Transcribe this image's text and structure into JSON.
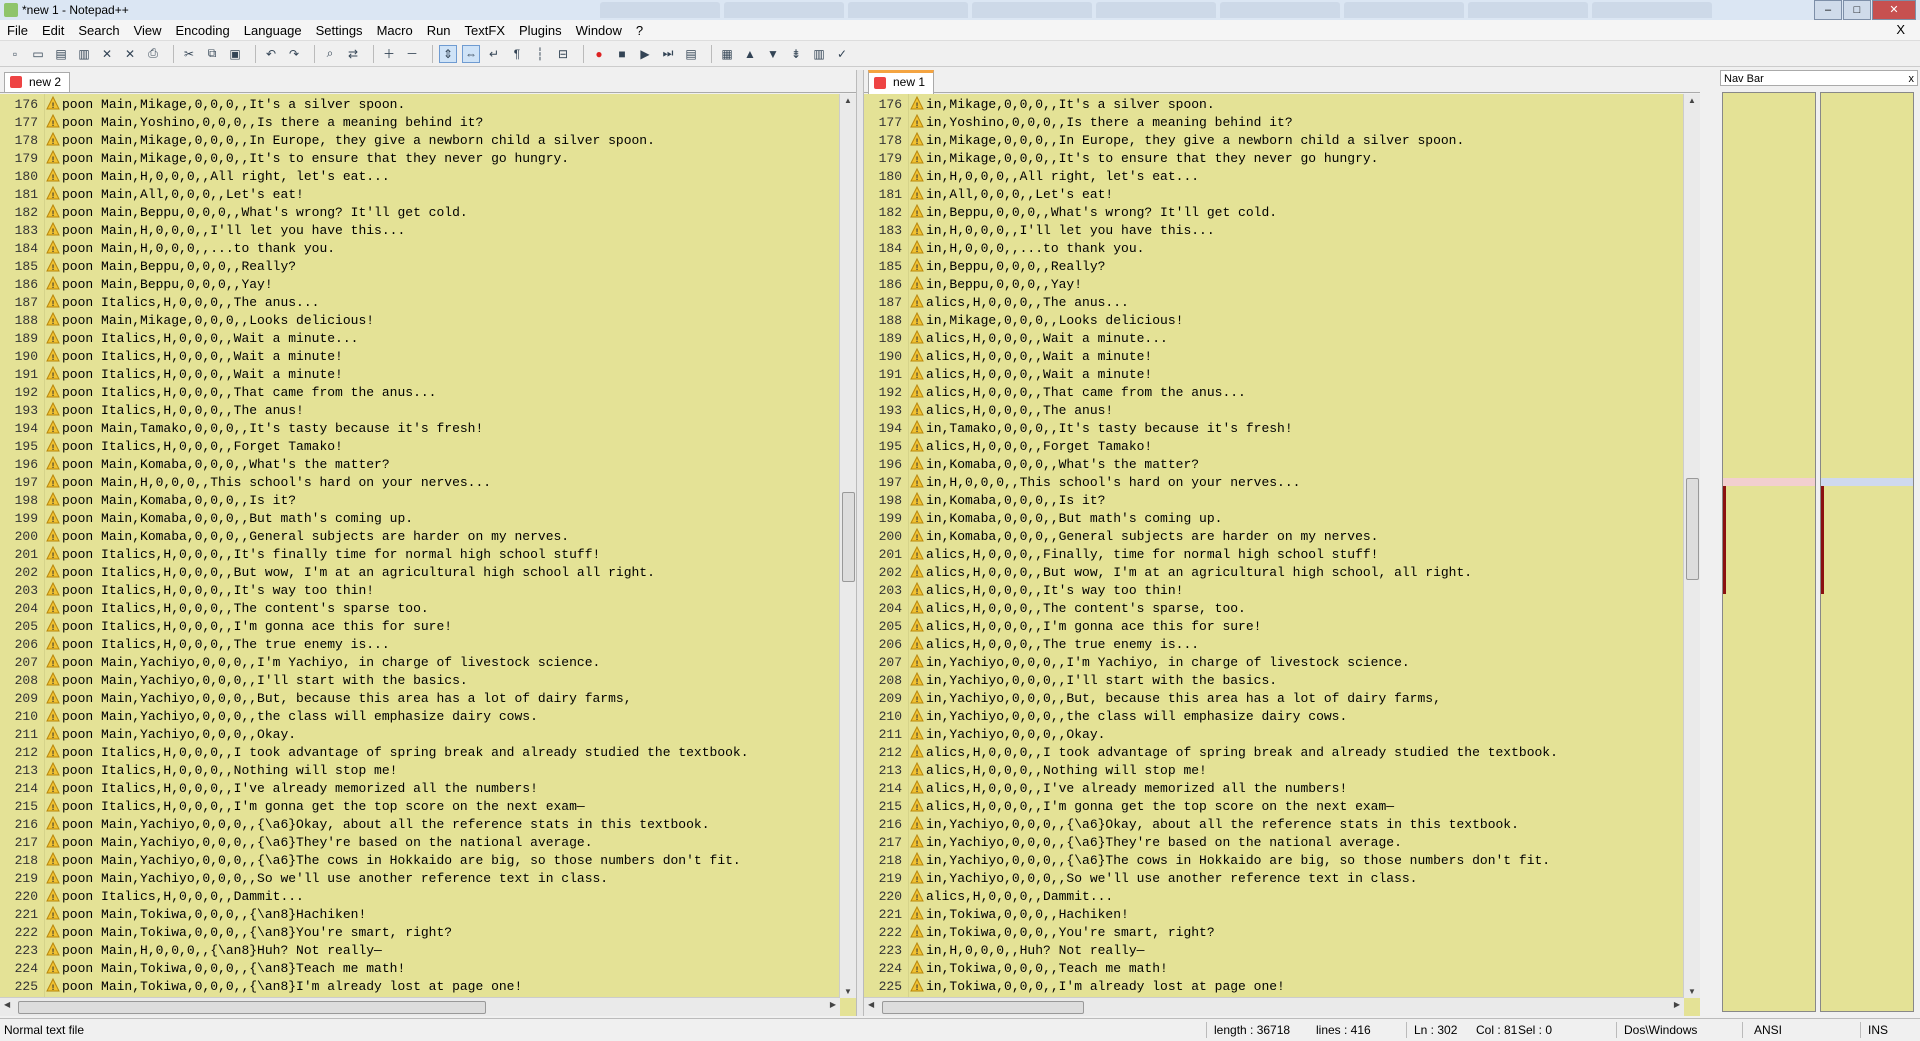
{
  "window": {
    "title": "*new 1 - Notepad++"
  },
  "menu": [
    "File",
    "Edit",
    "Search",
    "View",
    "Encoding",
    "Language",
    "Settings",
    "Macro",
    "Run",
    "TextFX",
    "Plugins",
    "Window",
    "?"
  ],
  "menu_close": "X",
  "toolbar_icons": [
    "new-file-icon",
    "open-file-icon",
    "save-icon",
    "save-all-icon",
    "close-icon",
    "close-all-icon",
    "print-icon",
    "cut-icon",
    "copy-icon",
    "paste-icon",
    "undo-icon",
    "redo-icon",
    "find-icon",
    "replace-icon",
    "zoom-in-icon",
    "zoom-out-icon",
    "sync-vertical-icon",
    "sync-horizontal-icon",
    "word-wrap-icon",
    "show-all-chars-icon",
    "indent-guide-icon",
    "fold-icon",
    "record-macro-icon",
    "stop-macro-icon",
    "play-macro-icon",
    "run-macro-multiple-icon",
    "save-macro-icon",
    "compare-icon",
    "prev-diff-icon",
    "next-diff-icon",
    "last-diff-icon",
    "navbar-icon",
    "spellcheck-icon"
  ],
  "left_pane": {
    "tab_label": "new 2",
    "prefix": "poon ",
    "lines": [
      {
        "n": "176",
        "t": "Main,Mikage,0,0,0,,It's a silver spoon."
      },
      {
        "n": "177",
        "t": "Main,Yoshino,0,0,0,,Is there a meaning behind it?"
      },
      {
        "n": "178",
        "t": "Main,Mikage,0,0,0,,In Europe, they give a newborn child a silver spoon."
      },
      {
        "n": "179",
        "t": "Main,Mikage,0,0,0,,It's to ensure that they never go hungry."
      },
      {
        "n": "180",
        "t": "Main,H,0,0,0,,All right, let's eat..."
      },
      {
        "n": "181",
        "t": "Main,All,0,0,0,,Let's eat!"
      },
      {
        "n": "182",
        "t": "Main,Beppu,0,0,0,,What's wrong? It'll get cold."
      },
      {
        "n": "183",
        "t": "Main,H,0,0,0,,I'll let you have this..."
      },
      {
        "n": "184",
        "t": "Main,H,0,0,0,,...to thank you."
      },
      {
        "n": "185",
        "t": "Main,Beppu,0,0,0,,Really?"
      },
      {
        "n": "186",
        "t": "Main,Beppu,0,0,0,,Yay!"
      },
      {
        "n": "187",
        "t": "Italics,H,0,0,0,,The anus..."
      },
      {
        "n": "188",
        "t": "Main,Mikage,0,0,0,,Looks delicious!"
      },
      {
        "n": "189",
        "t": "Italics,H,0,0,0,,Wait a minute..."
      },
      {
        "n": "190",
        "t": "Italics,H,0,0,0,,Wait a minute!"
      },
      {
        "n": "191",
        "t": "Italics,H,0,0,0,,Wait a minute!"
      },
      {
        "n": "192",
        "t": "Italics,H,0,0,0,,That came from the anus..."
      },
      {
        "n": "193",
        "t": "Italics,H,0,0,0,,The anus!"
      },
      {
        "n": "194",
        "t": "Main,Tamako,0,0,0,,It's tasty because it's fresh!"
      },
      {
        "n": "195",
        "t": "Italics,H,0,0,0,,Forget Tamako!"
      },
      {
        "n": "196",
        "t": "Main,Komaba,0,0,0,,What's the matter?"
      },
      {
        "n": "197",
        "t": "Main,H,0,0,0,,This school's hard on your nerves..."
      },
      {
        "n": "198",
        "t": "Main,Komaba,0,0,0,,Is it?"
      },
      {
        "n": "199",
        "t": "Main,Komaba,0,0,0,,But math's coming up."
      },
      {
        "n": "200",
        "t": "Main,Komaba,0,0,0,,General subjects are harder on my nerves."
      },
      {
        "n": "201",
        "t": "Italics,H,0,0,0,,It's finally time for normal high school stuff!"
      },
      {
        "n": "202",
        "t": "Italics,H,0,0,0,,But wow, I'm at an agricultural high school all right."
      },
      {
        "n": "203",
        "t": "Italics,H,0,0,0,,It's way too thin!"
      },
      {
        "n": "204",
        "t": "Italics,H,0,0,0,,The content's sparse too."
      },
      {
        "n": "205",
        "t": "Italics,H,0,0,0,,I'm gonna ace this for sure!"
      },
      {
        "n": "206",
        "t": "Italics,H,0,0,0,,The true enemy is..."
      },
      {
        "n": "207",
        "t": "Main,Yachiyo,0,0,0,,I'm Yachiyo, in charge of livestock science."
      },
      {
        "n": "208",
        "t": "Main,Yachiyo,0,0,0,,I'll start with the basics."
      },
      {
        "n": "209",
        "t": "Main,Yachiyo,0,0,0,,But, because this area has a lot of dairy farms,"
      },
      {
        "n": "210",
        "t": "Main,Yachiyo,0,0,0,,the class will emphasize dairy cows."
      },
      {
        "n": "211",
        "t": "Main,Yachiyo,0,0,0,,Okay."
      },
      {
        "n": "212",
        "t": "Italics,H,0,0,0,,I took advantage of spring break and already studied the textbook."
      },
      {
        "n": "213",
        "t": "Italics,H,0,0,0,,Nothing will stop me!"
      },
      {
        "n": "214",
        "t": "Italics,H,0,0,0,,I've already memorized all the numbers!"
      },
      {
        "n": "215",
        "t": "Italics,H,0,0,0,,I'm gonna get the top score on the next exam—"
      },
      {
        "n": "216",
        "t": "Main,Yachiyo,0,0,0,,{\\a6}Okay, about all the reference stats in this textbook."
      },
      {
        "n": "217",
        "t": "Main,Yachiyo,0,0,0,,{\\a6}They're based on the national average."
      },
      {
        "n": "218",
        "t": "Main,Yachiyo,0,0,0,,{\\a6}The cows in Hokkaido are big, so those numbers don't fit."
      },
      {
        "n": "219",
        "t": "Main,Yachiyo,0,0,0,,So we'll use another reference text in class."
      },
      {
        "n": "220",
        "t": "Italics,H,0,0,0,,Dammit..."
      },
      {
        "n": "221",
        "t": "Main,Tokiwa,0,0,0,,{\\an8}Hachiken!"
      },
      {
        "n": "222",
        "t": "Main,Tokiwa,0,0,0,,{\\an8}You're smart, right?"
      },
      {
        "n": "223",
        "t": "Main,H,0,0,0,,{\\an8}Huh? Not really—"
      },
      {
        "n": "224",
        "t": "Main,Tokiwa,0,0,0,,{\\an8}Teach me math!"
      },
      {
        "n": "225",
        "t": "Main,Tokiwa,0,0,0,,{\\an8}I'm already lost at page one!"
      }
    ]
  },
  "right_pane": {
    "tab_label": "new 1",
    "lines": [
      {
        "n": "176",
        "t": "in,Mikage,0,0,0,,It's a silver spoon."
      },
      {
        "n": "177",
        "t": "in,Yoshino,0,0,0,,Is there a meaning behind it?"
      },
      {
        "n": "178",
        "t": "in,Mikage,0,0,0,,In Europe, they give a newborn child a silver spoon."
      },
      {
        "n": "179",
        "t": "in,Mikage,0,0,0,,It's to ensure that they never go hungry."
      },
      {
        "n": "180",
        "t": "in,H,0,0,0,,All right, let's eat..."
      },
      {
        "n": "181",
        "t": "in,All,0,0,0,,Let's eat!"
      },
      {
        "n": "182",
        "t": "in,Beppu,0,0,0,,What's wrong? It'll get cold."
      },
      {
        "n": "183",
        "t": "in,H,0,0,0,,I'll let you have this..."
      },
      {
        "n": "184",
        "t": "in,H,0,0,0,,...to thank you."
      },
      {
        "n": "185",
        "t": "in,Beppu,0,0,0,,Really?"
      },
      {
        "n": "186",
        "t": "in,Beppu,0,0,0,,Yay!"
      },
      {
        "n": "187",
        "t": "alics,H,0,0,0,,The anus..."
      },
      {
        "n": "188",
        "t": "in,Mikage,0,0,0,,Looks delicious!"
      },
      {
        "n": "189",
        "t": "alics,H,0,0,0,,Wait a minute..."
      },
      {
        "n": "190",
        "t": "alics,H,0,0,0,,Wait a minute!"
      },
      {
        "n": "191",
        "t": "alics,H,0,0,0,,Wait a minute!"
      },
      {
        "n": "192",
        "t": "alics,H,0,0,0,,That came from the anus..."
      },
      {
        "n": "193",
        "t": "alics,H,0,0,0,,The anus!"
      },
      {
        "n": "194",
        "t": "in,Tamako,0,0,0,,It's tasty because it's fresh!"
      },
      {
        "n": "195",
        "t": "alics,H,0,0,0,,Forget Tamako!"
      },
      {
        "n": "196",
        "t": "in,Komaba,0,0,0,,What's the matter?"
      },
      {
        "n": "197",
        "t": "in,H,0,0,0,,This school's hard on your nerves..."
      },
      {
        "n": "198",
        "t": "in,Komaba,0,0,0,,Is it?"
      },
      {
        "n": "199",
        "t": "in,Komaba,0,0,0,,But math's coming up."
      },
      {
        "n": "200",
        "t": "in,Komaba,0,0,0,,General subjects are harder on my nerves."
      },
      {
        "n": "201",
        "t": "alics,H,0,0,0,,Finally, time for normal high school stuff!"
      },
      {
        "n": "202",
        "t": "alics,H,0,0,0,,But wow, I'm at an agricultural high school, all right."
      },
      {
        "n": "203",
        "t": "alics,H,0,0,0,,It's way too thin!"
      },
      {
        "n": "204",
        "t": "alics,H,0,0,0,,The content's sparse, too."
      },
      {
        "n": "205",
        "t": "alics,H,0,0,0,,I'm gonna ace this for sure!"
      },
      {
        "n": "206",
        "t": "alics,H,0,0,0,,The true enemy is..."
      },
      {
        "n": "207",
        "t": "in,Yachiyo,0,0,0,,I'm Yachiyo, in charge of livestock science."
      },
      {
        "n": "208",
        "t": "in,Yachiyo,0,0,0,,I'll start with the basics."
      },
      {
        "n": "209",
        "t": "in,Yachiyo,0,0,0,,But, because this area has a lot of dairy farms,"
      },
      {
        "n": "210",
        "t": "in,Yachiyo,0,0,0,,the class will emphasize dairy cows."
      },
      {
        "n": "211",
        "t": "in,Yachiyo,0,0,0,,Okay."
      },
      {
        "n": "212",
        "t": "alics,H,0,0,0,,I took advantage of spring break and already studied the textbook."
      },
      {
        "n": "213",
        "t": "alics,H,0,0,0,,Nothing will stop me!"
      },
      {
        "n": "214",
        "t": "alics,H,0,0,0,,I've already memorized all the numbers!"
      },
      {
        "n": "215",
        "t": "alics,H,0,0,0,,I'm gonna get the top score on the next exam—"
      },
      {
        "n": "216",
        "t": "in,Yachiyo,0,0,0,,{\\a6}Okay, about all the reference stats in this textbook."
      },
      {
        "n": "217",
        "t": "in,Yachiyo,0,0,0,,{\\a6}They're based on the national average."
      },
      {
        "n": "218",
        "t": "in,Yachiyo,0,0,0,,{\\a6}The cows in Hokkaido are big, so those numbers don't fit."
      },
      {
        "n": "219",
        "t": "in,Yachiyo,0,0,0,,So we'll use another reference text in class."
      },
      {
        "n": "220",
        "t": "alics,H,0,0,0,,Dammit..."
      },
      {
        "n": "221",
        "t": "in,Tokiwa,0,0,0,,Hachiken!"
      },
      {
        "n": "222",
        "t": "in,Tokiwa,0,0,0,,You're smart, right?"
      },
      {
        "n": "223",
        "t": "in,H,0,0,0,,Huh? Not really—"
      },
      {
        "n": "224",
        "t": "in,Tokiwa,0,0,0,,Teach me math!"
      },
      {
        "n": "225",
        "t": "in,Tokiwa,0,0,0,,I'm already lost at page one!"
      }
    ]
  },
  "navbar": {
    "title": "Nav Bar",
    "close": "x"
  },
  "status": {
    "file_type": "Normal text file",
    "length": "length : 36718",
    "lines": "lines : 416",
    "ln": "Ln : 302",
    "col": "Col : 81",
    "sel": "Sel : 0",
    "eol": "Dos\\Windows",
    "encoding": "ANSI",
    "mode": "INS"
  },
  "colors": {
    "editor_bg": "#e4e296",
    "highlight": "#d0cf88",
    "tab_accent": "#f4a441",
    "diff_marker": "#8a1010"
  }
}
